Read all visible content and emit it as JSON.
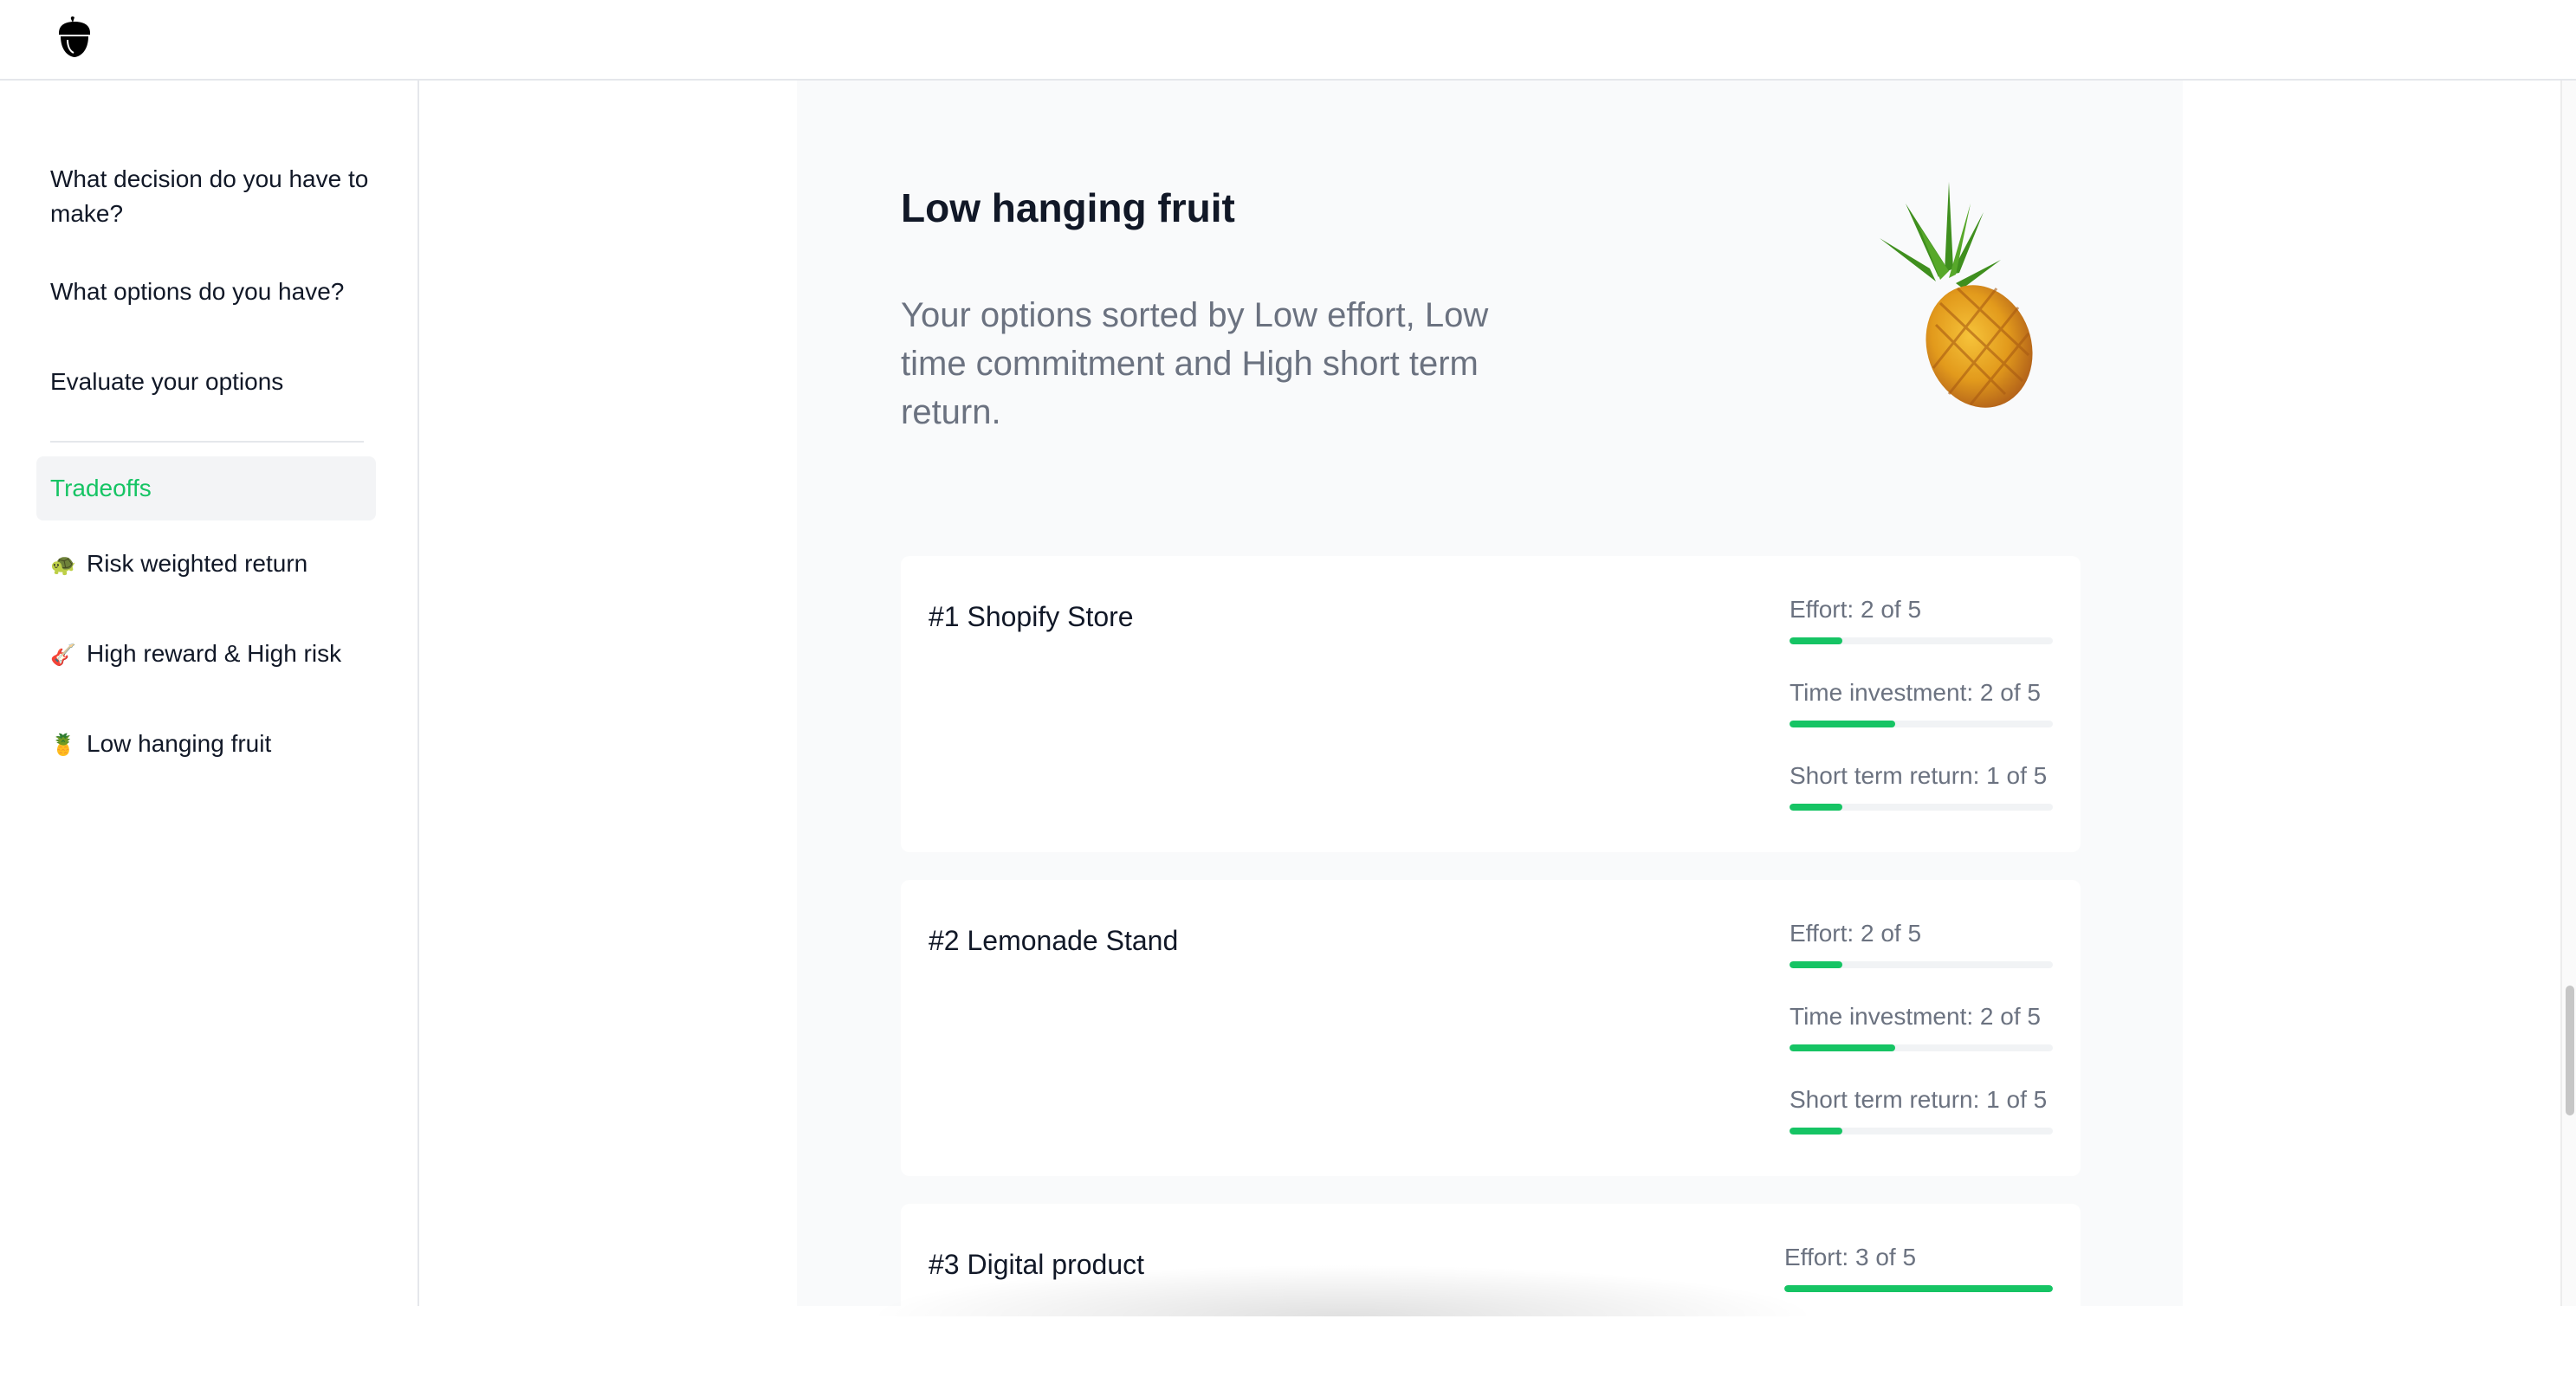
{
  "app": {
    "logo_icon": "acorn-icon",
    "accent_color": "#16c464"
  },
  "sidebar": {
    "items": [
      {
        "label": "What decision do you have to make?"
      },
      {
        "label": "What options do you have?"
      },
      {
        "label": "Evaluate your options"
      }
    ],
    "section": {
      "label": "Tradeoffs",
      "active": true
    },
    "subitems": [
      {
        "icon": "turtle-icon",
        "emoji": "🐢",
        "label": "Risk weighted return"
      },
      {
        "icon": "guitar-icon",
        "emoji": "🎸",
        "label": "High reward & High risk"
      },
      {
        "icon": "pineapple-icon",
        "emoji": "🍍",
        "label": "Low hanging fruit"
      }
    ]
  },
  "main": {
    "title": "Low hanging fruit",
    "description": "Your options sorted by Low effort, Low time commitment and High short term return.",
    "hero_icon": "pineapple-icon",
    "options": [
      {
        "title": "#1 Shopify Store",
        "metrics": [
          {
            "label": "Effort: 2 of 5",
            "value": 2,
            "max": 5,
            "fill_fraction": 0.2
          },
          {
            "label": "Time investment: 2 of 5",
            "value": 2,
            "max": 5,
            "fill_fraction": 0.4
          },
          {
            "label": "Short term return: 1 of 5",
            "value": 1,
            "max": 5,
            "fill_fraction": 0.2
          }
        ]
      },
      {
        "title": "#2 Lemonade Stand",
        "metrics": [
          {
            "label": "Effort: 2 of 5",
            "value": 2,
            "max": 5,
            "fill_fraction": 0.2
          },
          {
            "label": "Time investment: 2 of 5",
            "value": 2,
            "max": 5,
            "fill_fraction": 0.4
          },
          {
            "label": "Short term return: 1 of 5",
            "value": 1,
            "max": 5,
            "fill_fraction": 0.2
          }
        ]
      },
      {
        "title": "#3 Digital product",
        "metrics": [
          {
            "label": "Effort: 3 of 5",
            "value": 3,
            "max": 5,
            "fill_fraction": 1.0
          }
        ]
      }
    ]
  }
}
